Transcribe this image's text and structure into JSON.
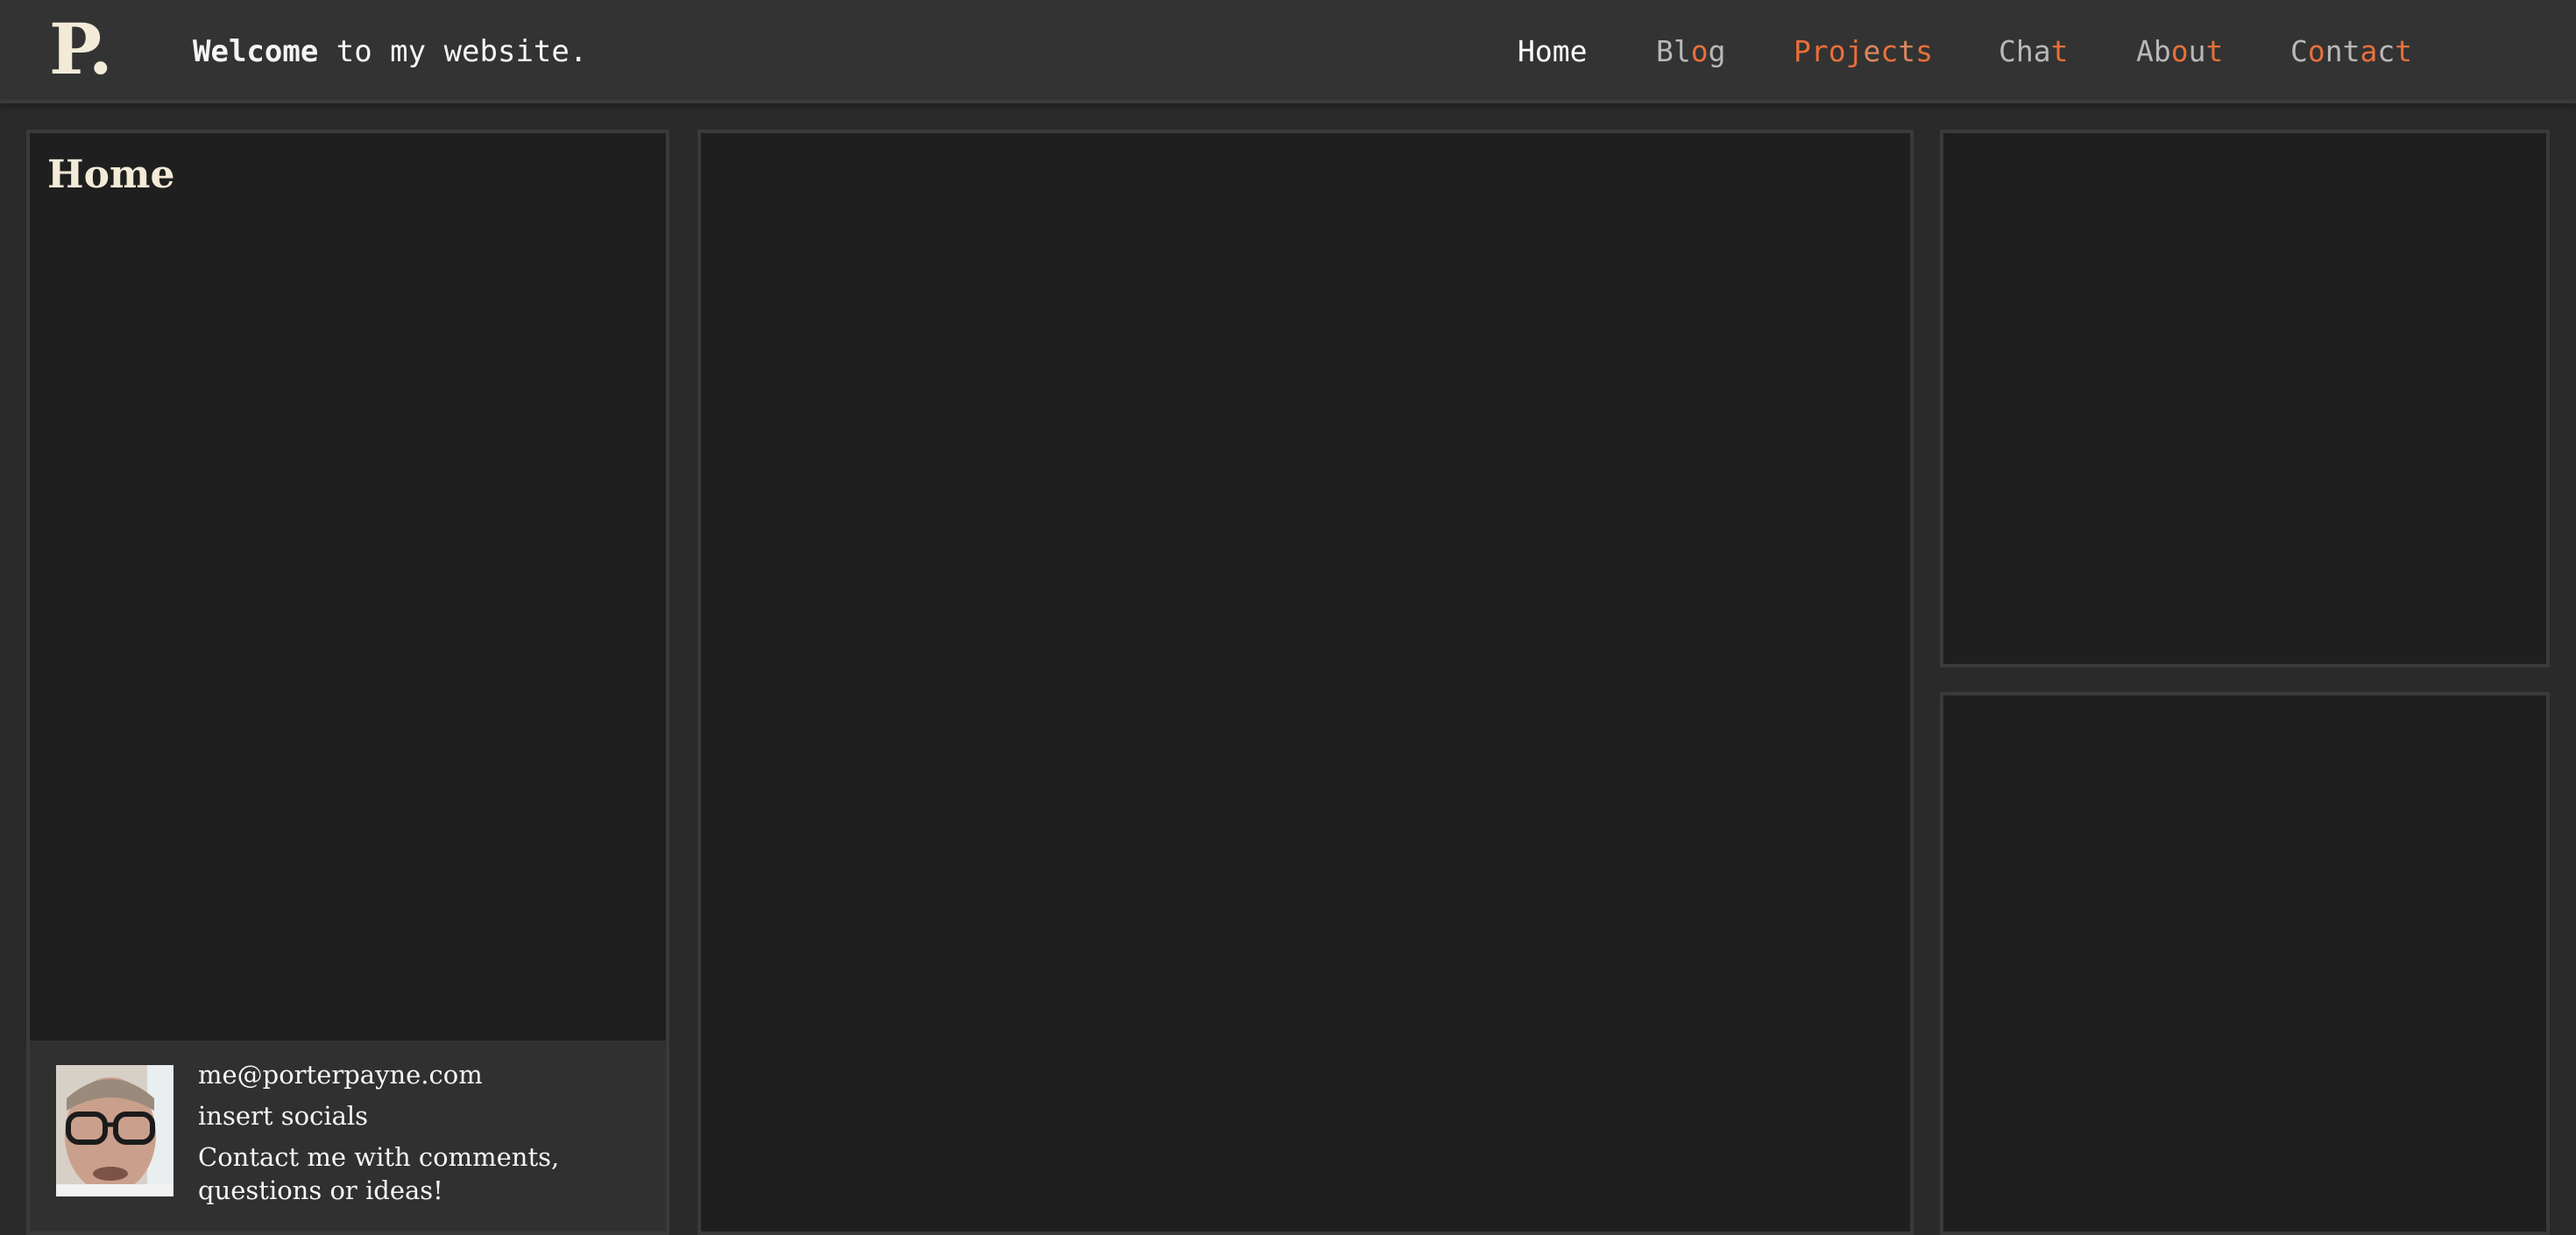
{
  "header": {
    "logo": "P.",
    "welcome_bold": "Welcome",
    "welcome_rest": " to my website.",
    "nav": [
      {
        "label": "Home",
        "color": "#ffffff"
      },
      {
        "label": "Blog",
        "color": "#b8b8b8",
        "accent_indices": [
          2
        ]
      },
      {
        "label": "Projects",
        "color": "#e8703a",
        "accent_indices": [],
        "muted_indices": [
          4,
          6
        ]
      },
      {
        "label": "Chat",
        "color": "#b8b8b8",
        "accent_indices": [
          3
        ]
      },
      {
        "label": "About",
        "color": "#b8b8b8",
        "accent_indices": [
          2,
          4
        ]
      },
      {
        "label": "Contact",
        "color": "#b8b8b8",
        "accent_indices": [
          1,
          4,
          6
        ]
      }
    ]
  },
  "left_panel": {
    "title": "Home",
    "contact": {
      "email": "me@porterpayne.com",
      "socials": "insert socials",
      "message": "Contact me with comments, questions or ideas!"
    }
  },
  "colors": {
    "accent": "#e8703a",
    "nav_muted": "#b8b8b8",
    "text_cream": "#f3ead8",
    "panel_bg": "#1f1f1f",
    "page_bg": "#2a2a2a",
    "header_bg": "#333333"
  },
  "icons": {
    "avatar": "profile-photo"
  }
}
